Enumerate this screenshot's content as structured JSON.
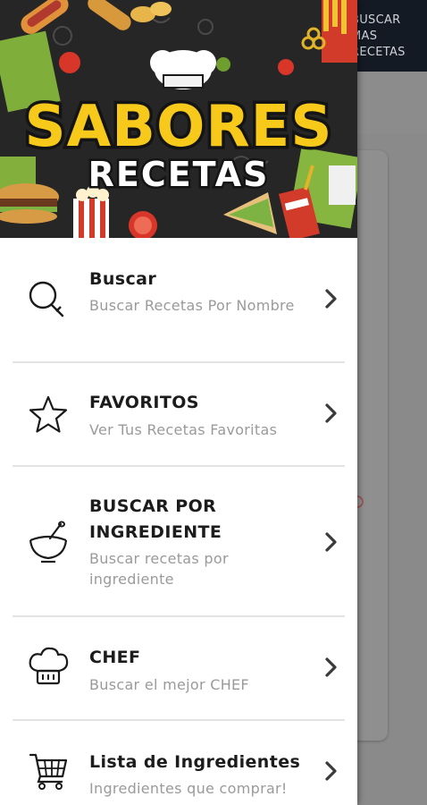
{
  "background_app": {
    "action_label_line1": "BUSCAR",
    "action_label_line2": "MAS",
    "action_label_line3": "RECETAS"
  },
  "header": {
    "logo_line1": "SABORES",
    "logo_line2": "RECETAS"
  },
  "menu": {
    "items": [
      {
        "title": "Buscar",
        "subtitle": "Buscar Recetas Por Nombre",
        "icon": "search-icon"
      },
      {
        "title": "FAVORITOS",
        "subtitle": "Ver Tus Recetas Favoritas",
        "icon": "star-icon"
      },
      {
        "title_line1": "BUSCAR POR",
        "title_line2": "INGREDIENTE",
        "subtitle_line1": "Buscar recetas por",
        "subtitle_line2": "ingrediente",
        "icon": "mortar-bowl-icon"
      },
      {
        "title": "CHEF",
        "subtitle": "Buscar el mejor CHEF",
        "icon": "chef-hat-icon"
      },
      {
        "title": "Lista de Ingredientes",
        "subtitle": "Ingredientes que comprar!",
        "icon": "cart-icon"
      }
    ]
  },
  "colors": {
    "logo_yellow": "#f7c91a",
    "title_text": "#1c1c1c",
    "subtitle_text": "#9a9a9a",
    "divider": "#e3e3e3"
  }
}
